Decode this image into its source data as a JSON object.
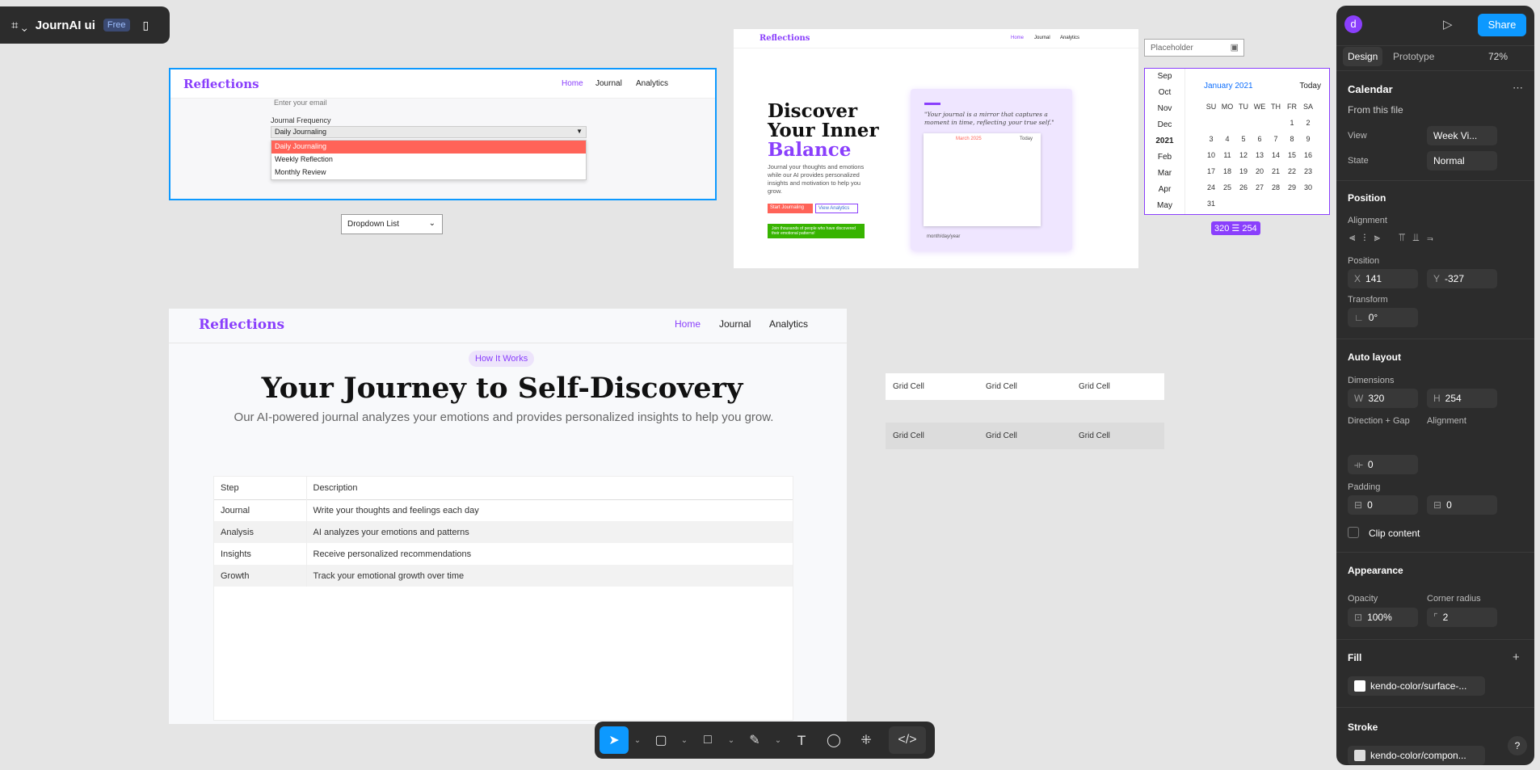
{
  "file": {
    "name": "JournAI ui",
    "plan": "Free"
  },
  "frame1": {
    "brand": "Reflections",
    "nav": [
      "Home",
      "Journal",
      "Analytics"
    ],
    "email_placeholder": "Enter your email",
    "freq_label": "Journal Frequency",
    "select_value": "Daily Journaling",
    "options": [
      "Daily Journaling",
      "Weekly Reflection",
      "Monthly Review"
    ]
  },
  "dropdown_list": {
    "label": "Dropdown List"
  },
  "frame2": {
    "brand": "Reflections",
    "nav": [
      "Home",
      "Journal",
      "Analytics"
    ],
    "h1a": "Discover",
    "h1b": "Your Inner",
    "h1c": "Balance",
    "body": "Journal your thoughts and emotions while our AI provides personalized insights and motivation to help you grow.",
    "btn_start": "Start Journaling",
    "btn_analytics": "View Analytics",
    "toast": "Join thousands of people who have discovered their emotional patterns!",
    "quote": "\"Your journal is a mirror that captures a moment in time, reflecting your true self.\"",
    "mini_month": "March 2025",
    "mini_today": "Today",
    "mini_input": "month/day/year"
  },
  "datepicker": {
    "placeholder": "Placeholder",
    "months_left": [
      "Sep",
      "Oct",
      "Nov",
      "Dec",
      "2021",
      "Feb",
      "Mar",
      "Apr",
      "May"
    ],
    "title": "January 2021",
    "today": "Today",
    "weekdays": [
      "SU",
      "MO",
      "TU",
      "WE",
      "TH",
      "FR",
      "SA"
    ],
    "weeks": [
      [
        "",
        "",
        "",
        "",
        "",
        "1",
        "2"
      ],
      [
        "3",
        "4",
        "5",
        "6",
        "7",
        "8",
        "9"
      ],
      [
        "10",
        "11",
        "12",
        "13",
        "14",
        "15",
        "16"
      ],
      [
        "17",
        "18",
        "19",
        "20",
        "21",
        "22",
        "23"
      ],
      [
        "24",
        "25",
        "26",
        "27",
        "28",
        "29",
        "30"
      ],
      [
        "31",
        "",
        "",
        "",
        "",
        "",
        ""
      ]
    ],
    "size_badge": "320 ☰ 254"
  },
  "frame3": {
    "brand": "Reflections",
    "nav": [
      "Home",
      "Journal",
      "Analytics"
    ],
    "pill": "How It Works",
    "title": "Your Journey to Self-Discovery",
    "subtitle": "Our AI-powered journal analyzes your emotions and provides personalized insights to help you grow.",
    "table": {
      "headers": [
        "Step",
        "Description"
      ],
      "rows": [
        [
          "Journal",
          "Write your thoughts and feelings each day"
        ],
        [
          "Analysis",
          "AI analyzes your emotions and patterns"
        ],
        [
          "Insights",
          "Receive personalized recommendations"
        ],
        [
          "Growth",
          "Track your emotional growth over time"
        ]
      ]
    }
  },
  "grid_rows": [
    [
      "Grid Cell",
      "Grid Cell",
      "Grid Cell"
    ],
    [
      "Grid Cell",
      "Grid Cell",
      "Grid Cell"
    ]
  ],
  "panel": {
    "avatar": "d",
    "share": "Share",
    "tabs": [
      "Design",
      "Prototype"
    ],
    "zoom": "72%",
    "component": "Calendar",
    "from_file": "From this file",
    "view_label": "View",
    "view_value": "Week Vi...",
    "state_label": "State",
    "state_value": "Normal",
    "position_hd": "Position",
    "alignment_lbl": "Alignment",
    "position_lbl": "Position",
    "x": "141",
    "y": "-327",
    "transform_lbl": "Transform",
    "rotation": "0°",
    "autolayout_hd": "Auto layout",
    "dimensions_lbl": "Dimensions",
    "w": "320",
    "h": "254",
    "direction_lbl": "Direction + Gap",
    "alignment2_lbl": "Alignment",
    "gap": "0",
    "padding_lbl": "Padding",
    "pad_h": "0",
    "pad_v": "0",
    "clip": "Clip content",
    "appearance_hd": "Appearance",
    "opacity_lbl": "Opacity",
    "opacity": "100%",
    "radius_lbl": "Corner radius",
    "radius": "2",
    "fill_hd": "Fill",
    "fill_value": "kendo-color/surface-...",
    "stroke_hd": "Stroke",
    "stroke_value": "kendo-color/compon..."
  },
  "colors": {
    "accent": "#0d99ff",
    "brand": "#8a3ffc",
    "danger": "#ff6358",
    "success": "#37b400"
  }
}
